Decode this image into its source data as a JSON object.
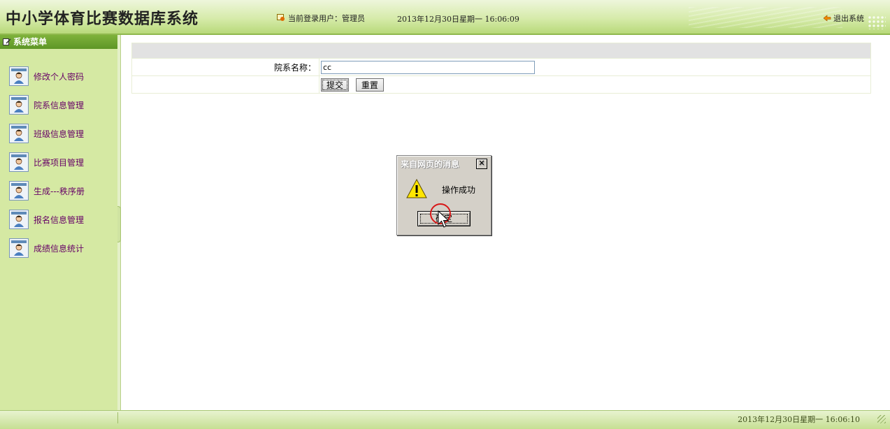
{
  "header": {
    "title": "中小学体育比赛数据库系统",
    "user_label": "当前登录用户：管理员",
    "datetime": "2013年12月30日星期一  16:06:09",
    "logout_label": "退出系统"
  },
  "sidebar": {
    "title": "系统菜单",
    "items": [
      {
        "label": "修改个人密码",
        "icon": "user-card-icon"
      },
      {
        "label": "院系信息管理",
        "icon": "user-card-icon"
      },
      {
        "label": "班级信息管理",
        "icon": "user-card-icon"
      },
      {
        "label": "比赛项目管理",
        "icon": "user-card-icon"
      },
      {
        "label": "生成---秩序册",
        "icon": "user-card-icon"
      },
      {
        "label": "报名信息管理",
        "icon": "user-card-icon"
      },
      {
        "label": "成绩信息统计",
        "icon": "user-card-icon"
      }
    ]
  },
  "form": {
    "field_label": "院系名称：",
    "field_value": "cc",
    "submit_label": "提交",
    "reset_label": "重置"
  },
  "dialog": {
    "title": "来自网页的消息",
    "message": "操作成功",
    "ok_label": "确定",
    "icon": "warning-icon"
  },
  "footer": {
    "datetime": "2013年12月30日星期一  16:06:10"
  },
  "colors": {
    "header_green": "#b8d97a",
    "sidebar_bg": "#d5e9a3",
    "menu_title_green": "#5d9626",
    "menu_text": "#660066",
    "dialog_gray": "#d4d0c8"
  }
}
